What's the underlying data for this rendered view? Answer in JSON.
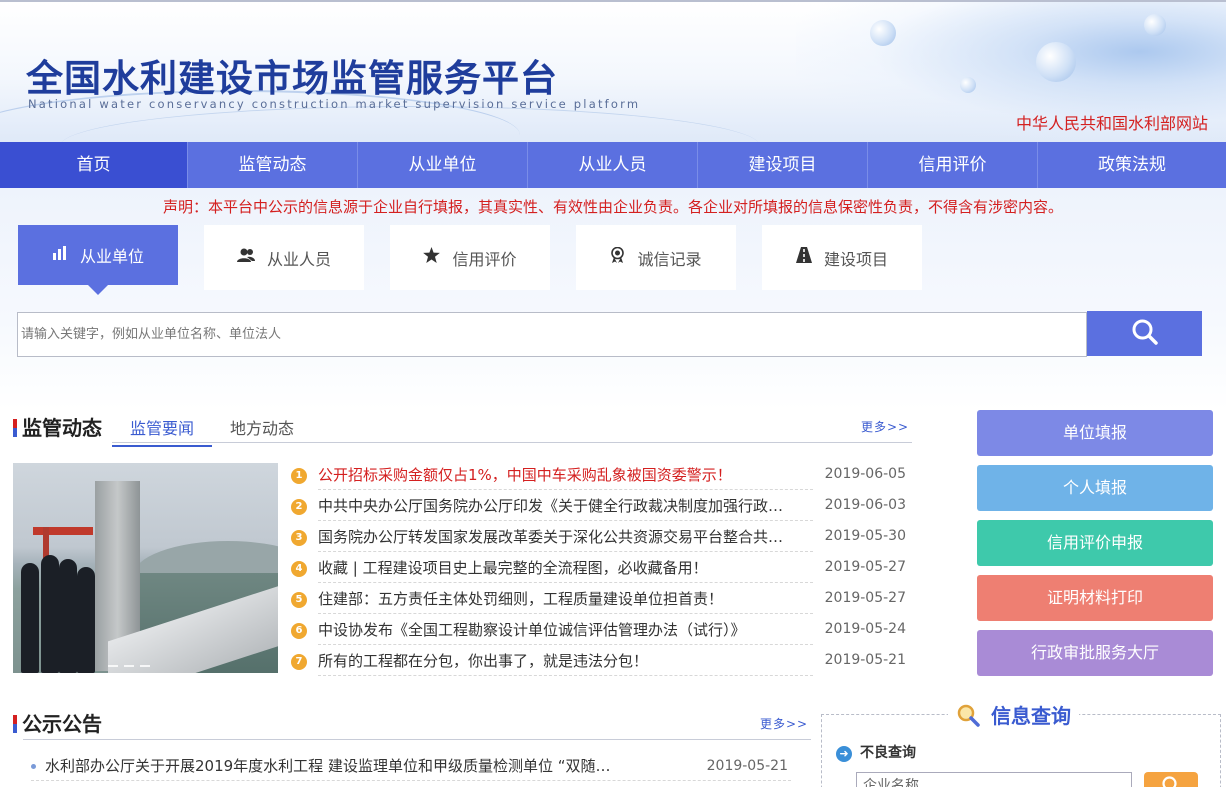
{
  "header": {
    "title": "全国水利建设市场监管服务平台",
    "subtitle": "National water conservancy construction market supervision service platform",
    "ministry_link": "中华人民共和国水利部网站"
  },
  "nav": {
    "items": [
      {
        "label": "首页"
      },
      {
        "label": "监管动态"
      },
      {
        "label": "从业单位"
      },
      {
        "label": "从业人员"
      },
      {
        "label": "建设项目"
      },
      {
        "label": "信用评价"
      },
      {
        "label": "政策法规"
      }
    ]
  },
  "notice": "声明：本平台中公示的信息源于企业自行填报，其真实性、有效性由企业负责。各企业对所填报的信息保密性负责，不得含有涉密内容。",
  "search": {
    "tabs": [
      {
        "label": "从业单位",
        "icon": "bar-chart-icon"
      },
      {
        "label": "从业人员",
        "icon": "users-icon"
      },
      {
        "label": "信用评价",
        "icon": "star-icon"
      },
      {
        "label": "诚信记录",
        "icon": "badge-icon"
      },
      {
        "label": "建设项目",
        "icon": "road-icon"
      }
    ],
    "placeholder": "请输入关键字，例如从业单位名称、单位法人",
    "button_icon": "search-icon"
  },
  "news_section": {
    "title": "监管动态",
    "tabs": [
      {
        "label": "监管要闻"
      },
      {
        "label": "地方动态"
      }
    ],
    "more": "更多>>",
    "items": [
      {
        "num": "1",
        "title": "公开招标采购金额仅占1%，中国中车采购乱象被国资委警示！",
        "date": "2019-06-05",
        "highlight": true
      },
      {
        "num": "2",
        "title": "中共中央办公厅国务院办公厅印发《关于健全行政裁决制度加强行政…",
        "date": "2019-06-03",
        "highlight": false
      },
      {
        "num": "3",
        "title": "国务院办公厅转发国家发展改革委关于深化公共资源交易平台整合共…",
        "date": "2019-05-30",
        "highlight": false
      },
      {
        "num": "4",
        "title": "收藏 | 工程建设项目史上最完整的全流程图，必收藏备用！",
        "date": "2019-05-27",
        "highlight": false
      },
      {
        "num": "5",
        "title": "住建部：五方责任主体处罚细则，工程质量建设单位担首责！",
        "date": "2019-05-27",
        "highlight": false
      },
      {
        "num": "6",
        "title": "中设协发布《全国工程勘察设计单位诚信评估管理办法（试行）》",
        "date": "2019-05-24",
        "highlight": false
      },
      {
        "num": "7",
        "title": "所有的工程都在分包，你出事了，就是违法分包！",
        "date": "2019-05-21",
        "highlight": false
      }
    ]
  },
  "announce_section": {
    "title": "公示公告",
    "more": "更多>>",
    "items": [
      {
        "title": "水利部办公厅关于开展2019年度水利工程 建设监理单位和甲级质量检测单位 “双随…",
        "date": "2019-05-21"
      }
    ]
  },
  "side_buttons": [
    {
      "label": "单位填报",
      "color": "#7d89e6"
    },
    {
      "label": "个人填报",
      "color": "#6fb3e8"
    },
    {
      "label": "信用评价申报",
      "color": "#3ec9ab"
    },
    {
      "label": "证明材料打印",
      "color": "#ee7f72"
    },
    {
      "label": "行政审批服务大厅",
      "color": "#a98bd6"
    }
  ],
  "info_query": {
    "title": "信息查询",
    "subsection": "不良查询",
    "input_placeholder": "企业名称",
    "query_icon": "search-icon"
  },
  "colors": {
    "nav": "#5b70e0",
    "nav_active": "#3a4fd2",
    "accent": "#3a5bd0",
    "alert": "#d42020"
  }
}
